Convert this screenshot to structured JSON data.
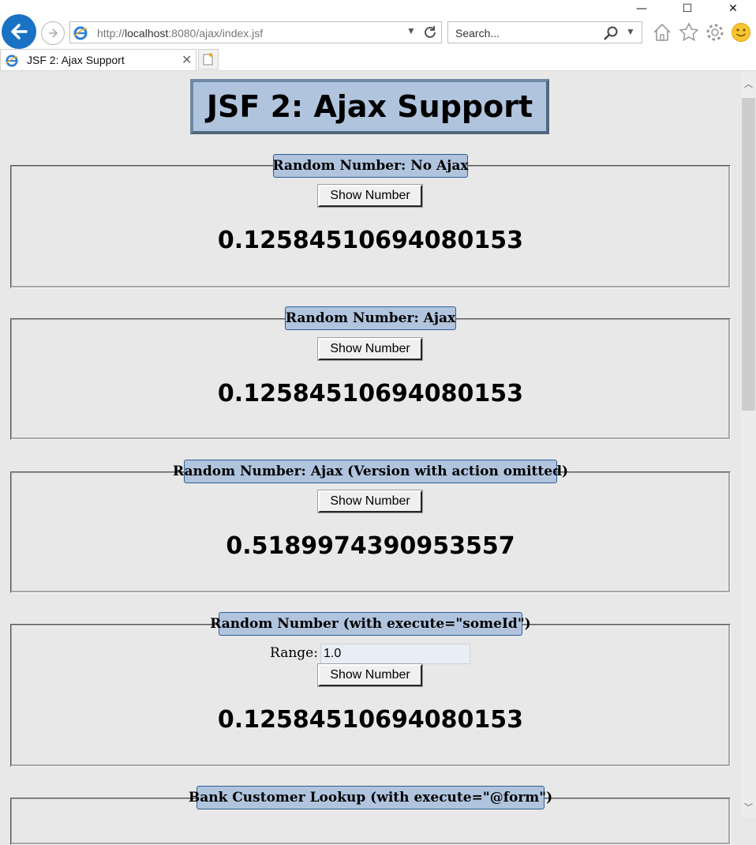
{
  "window": {
    "minimize": "—",
    "maximize": "☐",
    "close": "✕"
  },
  "browser": {
    "url_prefix": "http://",
    "url_host": "localhost",
    "url_rest": ":8080/ajax/index.jsf",
    "search_placeholder": "Search...",
    "tab_title": "JSF 2: Ajax Support"
  },
  "page": {
    "title": "JSF 2: Ajax Support",
    "panels": [
      {
        "legend": "Random Number: No Ajax",
        "button": "Show Number",
        "value": "0.12584510694080153"
      },
      {
        "legend": "Random Number: Ajax",
        "button": "Show Number",
        "value": "0.12584510694080153"
      },
      {
        "legend": "Random Number: Ajax (Version with action omitted)",
        "button": "Show Number",
        "value": "0.5189974390953557"
      },
      {
        "legend": "Random Number (with execute=\"someId\")",
        "range_label": "Range:",
        "range_value": "1.0",
        "button": "Show Number",
        "value": "0.12584510694080153"
      },
      {
        "legend": "Bank Customer Lookup (with execute=\"@form\")"
      }
    ]
  }
}
